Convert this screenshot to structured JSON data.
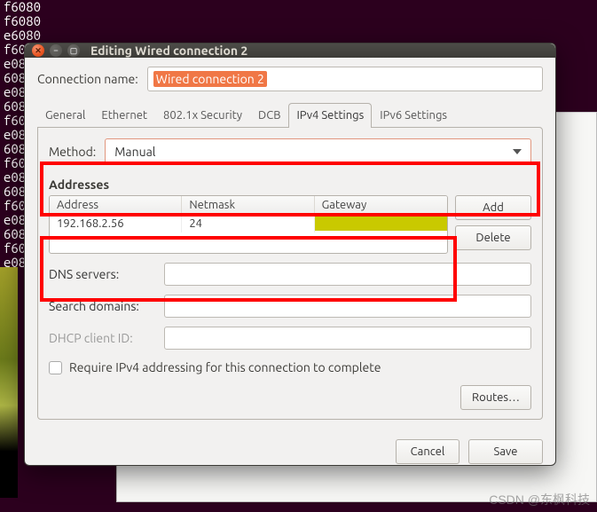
{
  "terminal_lines": "f6080\nf6080\ne6080\nf6080\ne08\n608\ne08\n608\nf60\ne08\n608\nf60\ne08\n608\nf60\ne08\n608\nf60\ne08",
  "window": {
    "title": "Editing Wired connection 2"
  },
  "connection": {
    "name_label": "Connection name:",
    "name_value": "Wired connection 2"
  },
  "tabs": [
    {
      "label": "General"
    },
    {
      "label": "Ethernet"
    },
    {
      "label": "802.1x Security"
    },
    {
      "label": "DCB"
    },
    {
      "label": "IPv4 Settings",
      "active": true
    },
    {
      "label": "IPv6 Settings"
    }
  ],
  "ipv4": {
    "method_label": "Method:",
    "method_value": "Manual",
    "addresses_title": "Addresses",
    "columns": {
      "address": "Address",
      "netmask": "Netmask",
      "gateway": "Gateway"
    },
    "rows": [
      {
        "address": "192.168.2.56",
        "netmask": "24",
        "gateway": ""
      }
    ],
    "buttons": {
      "add": "Add",
      "delete": "Delete"
    },
    "dns_label": "DNS servers:",
    "search_label": "Search domains:",
    "dhcp_label": "DHCP client ID:",
    "require_checkbox": "Require IPv4 addressing for this connection to complete",
    "routes": "Routes…"
  },
  "actions": {
    "cancel": "Cancel",
    "save": "Save"
  },
  "watermark": "CSDN @东枫科技"
}
